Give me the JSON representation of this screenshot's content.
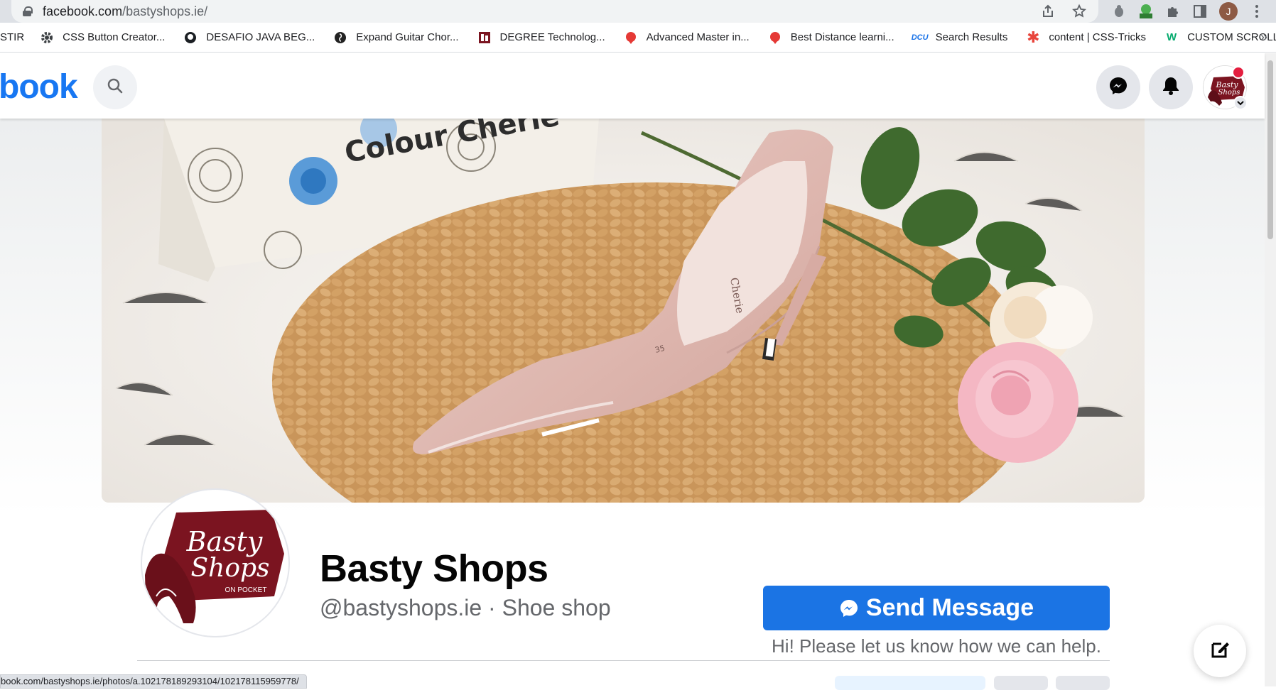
{
  "browser": {
    "url_domain": "facebook.com",
    "url_path": "/bastyshops.ie/",
    "profile_initial": "J",
    "bookmarks": [
      {
        "label": "STIR",
        "icon": "none"
      },
      {
        "label": "CSS Button Creator...",
        "icon": "gear-icon"
      },
      {
        "label": "DESAFIO JAVA BEG...",
        "icon": "github-icon"
      },
      {
        "label": "Expand Guitar Chor...",
        "icon": "guitar-icon"
      },
      {
        "label": "DEGREE Technolog...",
        "icon": "degree-icon"
      },
      {
        "label": "Advanced Master in...",
        "icon": "red-globe-icon"
      },
      {
        "label": "Best Distance learni...",
        "icon": "red-globe-icon"
      },
      {
        "label": "Search Results",
        "icon": "dcu-icon"
      },
      {
        "label": "content | CSS-Tricks",
        "icon": "asterisk-icon"
      },
      {
        "label": "CUSTOM SCROLLBAR",
        "icon": "w3-icon"
      }
    ],
    "more_glyph": "»",
    "status_url": "book.com/bastyshops.ie/photos/a.102178189293104/102178115959778/"
  },
  "header": {
    "logo_text": "book"
  },
  "cover": {
    "box_text": "Colour Cherie",
    "shoe_brand": "Cherie",
    "insole_size": "35"
  },
  "profile": {
    "logo_line1": "Basty",
    "logo_line2": "Shops",
    "logo_tag": "ON POCKET",
    "name": "Basty Shops",
    "handle_category": "@bastyshops.ie · Shoe shop"
  },
  "actions": {
    "send_message": "Send Message",
    "help_text": "Hi! Please let us know how we can help."
  },
  "colors": {
    "fb_blue": "#1877f2",
    "button_blue": "#1b74e4",
    "brand_maroon": "#7b1420"
  }
}
